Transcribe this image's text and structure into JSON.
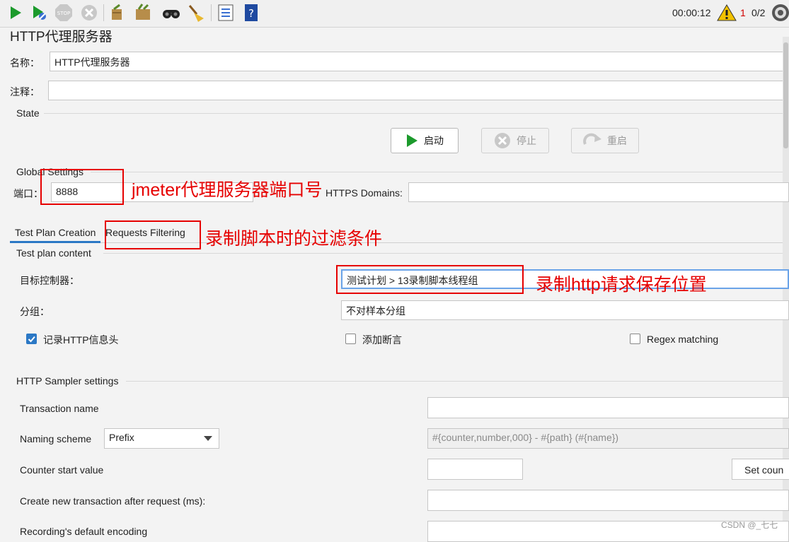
{
  "toolbar": {
    "icons": [
      "start-icon",
      "start-no-pause-icon",
      "stop-icon",
      "shutdown-icon",
      "clear-icon",
      "clear-all-icon",
      "search-icon",
      "reset-search-icon",
      "function-helper-icon",
      "help-icon"
    ],
    "timer": "00:00:12",
    "warning_count": "1",
    "threads": "0/2"
  },
  "panel": {
    "title": "HTTP代理服务器",
    "name_label": "名称：",
    "name_value": "HTTP代理服务器",
    "comment_label": "注释：",
    "comment_value": ""
  },
  "state": {
    "title": "State",
    "start_label": "启动",
    "stop_label": "停止",
    "restart_label": "重启"
  },
  "global": {
    "title": "Global Settings",
    "port_label": "端口：",
    "port_value": "8888",
    "https_label": "HTTPS Domains:",
    "https_value": ""
  },
  "tabs": [
    {
      "label": "Test Plan Creation",
      "active": true
    },
    {
      "label": "Requests Filtering",
      "active": false
    }
  ],
  "plan": {
    "title": "Test plan content",
    "target_label": "目标控制器：",
    "target_value": "测试计划 > 13录制脚本线程组",
    "group_label": "分组：",
    "group_value": "不对样本分组",
    "record_headers_label": "记录HTTP信息头",
    "record_headers_checked": true,
    "add_assert_label": "添加断言",
    "add_assert_checked": false,
    "regex_label": "Regex matching",
    "regex_checked": false
  },
  "sampler": {
    "title": "HTTP Sampler settings",
    "transaction_label": "Transaction name",
    "transaction_value": "",
    "naming_label": "Naming scheme",
    "naming_value": "Prefix",
    "naming_format": "#{counter,number,000} - #{path} (#{name})",
    "counter_label": "Counter start value",
    "counter_value": "",
    "set_counter_label": "Set coun",
    "new_tx_label": "Create new transaction after request (ms):",
    "new_tx_value": "",
    "encoding_label": "Recording's default encoding",
    "encoding_value": ""
  },
  "annotations": {
    "port_note": "jmeter代理服务器端口号",
    "filter_note": "录制脚本时的过滤条件",
    "save_note": "录制http请求保存位置"
  },
  "watermark": "CSDN @_七七",
  "colors": {
    "annotation": "#e60000",
    "accent": "#2b78c5",
    "play": "#1c9a2c"
  }
}
